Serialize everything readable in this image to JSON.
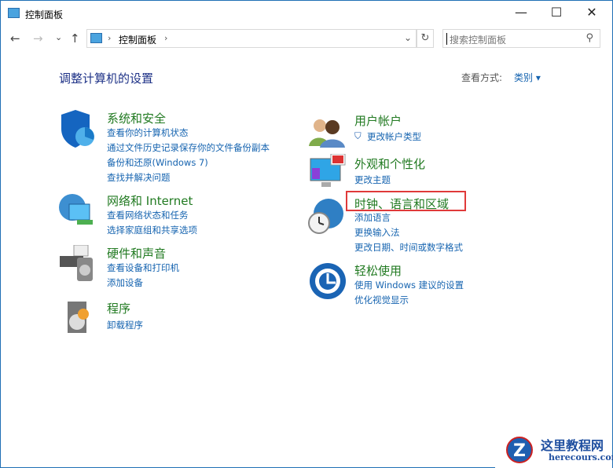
{
  "window": {
    "title": "控制面板",
    "minimize": "—",
    "maximize": "☐",
    "close": "✕"
  },
  "nav": {
    "back": "←",
    "forward": "→",
    "recent": "⌄",
    "up": "↑",
    "breadcrumb": "控制面板",
    "sep": "›",
    "dropdown": "⌄",
    "refresh": "↻"
  },
  "search": {
    "placeholder": "搜索控制面板",
    "icon": "⚲"
  },
  "main": {
    "heading": "调整计算机的设置",
    "view_by_label": "查看方式:",
    "view_by_value": "类别 ▾"
  },
  "categories": [
    {
      "title": "系统和安全",
      "links": [
        "查看你的计算机状态",
        "通过文件历史记录保存你的文件备份副本",
        "备份和还原(Windows 7)",
        "查找并解决问题"
      ]
    },
    {
      "title": "网络和 Internet",
      "links": [
        "查看网络状态和任务",
        "选择家庭组和共享选项"
      ]
    },
    {
      "title": "硬件和声音",
      "links": [
        "查看设备和打印机",
        "添加设备"
      ]
    },
    {
      "title": "程序",
      "links": [
        "卸载程序"
      ]
    },
    {
      "title": "用户帐户",
      "links": [
        "更改帐户类型"
      ]
    },
    {
      "title": "外观和个性化",
      "links": [
        "更改主题"
      ]
    },
    {
      "title": "时钟、语言和区域",
      "links": [
        "添加语言",
        "更换输入法",
        "更改日期、时间或数字格式"
      ]
    },
    {
      "title": "轻松使用",
      "links": [
        "使用 Windows 建议的设置",
        "优化视觉显示"
      ]
    }
  ],
  "watermark": {
    "name": "这里教程网",
    "url": "herecours.com"
  }
}
